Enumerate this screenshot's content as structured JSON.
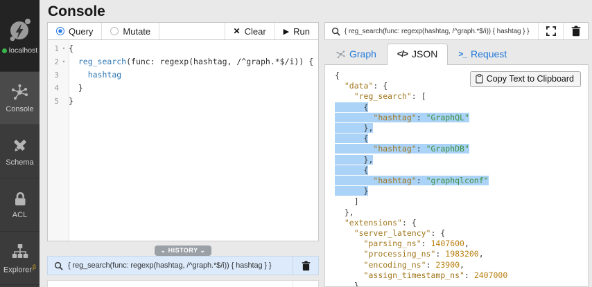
{
  "header": {
    "title": "Console"
  },
  "sidebar": {
    "items": [
      {
        "id": "localhost",
        "label": "localhost",
        "icon": "dgraph-logo-icon",
        "online": true
      },
      {
        "id": "console",
        "label": "Console",
        "icon": "console-graph-icon",
        "selected": true
      },
      {
        "id": "schema",
        "label": "Schema",
        "icon": "schema-tools-icon"
      },
      {
        "id": "acl",
        "label": "ACL",
        "icon": "acl-lock-icon"
      },
      {
        "id": "explorer",
        "label": "Explorer",
        "icon": "explorer-sitemap-icon",
        "badge": "β"
      }
    ]
  },
  "query_panel": {
    "mode_tabs": [
      {
        "label": "Query",
        "selected": true
      },
      {
        "label": "Mutate",
        "selected": false
      }
    ],
    "clear_button": {
      "icon": "✕",
      "label": "Clear"
    },
    "run_button": {
      "icon": "▶",
      "label": "Run"
    },
    "editor_lines": [
      {
        "num": "1",
        "fold": "▾",
        "tokens": [
          [
            "p",
            "{"
          ]
        ]
      },
      {
        "num": "2",
        "fold": "▾",
        "tokens": [
          [
            "p",
            "  "
          ],
          [
            "v",
            "reg_search"
          ],
          [
            "p",
            "(func: regexp(hashtag, /^graph.*$/i)) {"
          ]
        ]
      },
      {
        "num": "3",
        "fold": "",
        "tokens": [
          [
            "p",
            "    "
          ],
          [
            "v",
            "hashtag"
          ]
        ]
      },
      {
        "num": "4",
        "fold": "",
        "tokens": [
          [
            "p",
            "  }"
          ]
        ]
      },
      {
        "num": "5",
        "fold": "",
        "tokens": [
          [
            "p",
            "}"
          ]
        ]
      }
    ],
    "history": {
      "toggle_label": "⌄ HISTORY ⌄",
      "items": [
        {
          "text": "{ reg_search(func: regexp(hashtag, /^graph.*$/i)) { hashtag } }",
          "selected": true
        }
      ]
    }
  },
  "result_panel": {
    "query_bar": {
      "value": "{ reg_search(func: regexp(hashtag, /^graph.*$/i)) { hashtag } }"
    },
    "tabs": [
      {
        "label": "Graph",
        "icon": "graph-network-icon",
        "active": false
      },
      {
        "label": "JSON",
        "icon": "</>",
        "active": true
      },
      {
        "label": "Request",
        "icon": ">_",
        "active": false
      }
    ],
    "copy_button_label": "Copy Text to Clipboard",
    "json_selected_lines": [
      3,
      4,
      5,
      6,
      7,
      8,
      9,
      10,
      11
    ],
    "json_lines": [
      "{",
      "  \"data\": {",
      "    \"reg_search\": [",
      "      {",
      "        \"hashtag\": \"GraphQL\"",
      "      },",
      "      {",
      "        \"hashtag\": \"GraphDB\"",
      "      },",
      "      {",
      "        \"hashtag\": \"graphqlconf\"",
      "      }",
      "    ]",
      "  },",
      "  \"extensions\": {",
      "    \"server_latency\": {",
      "      \"parsing_ns\": 1407600,",
      "      \"processing_ns\": 1983200,",
      "      \"encoding_ns\": 23900,",
      "      \"assign_timestamp_ns\": 2407000",
      "    },"
    ]
  },
  "colors": {
    "accent_blue": "#2b7de9",
    "tab_link_blue": "#2279da",
    "selection_blue": "#abd3f7",
    "history_row_blue": "#dceafb",
    "json_key": "#a1771d",
    "json_string": "#3d9140",
    "json_number": "#b97f0e",
    "editor_field_blue": "#2e77b5",
    "online_green": "#39b54a"
  }
}
